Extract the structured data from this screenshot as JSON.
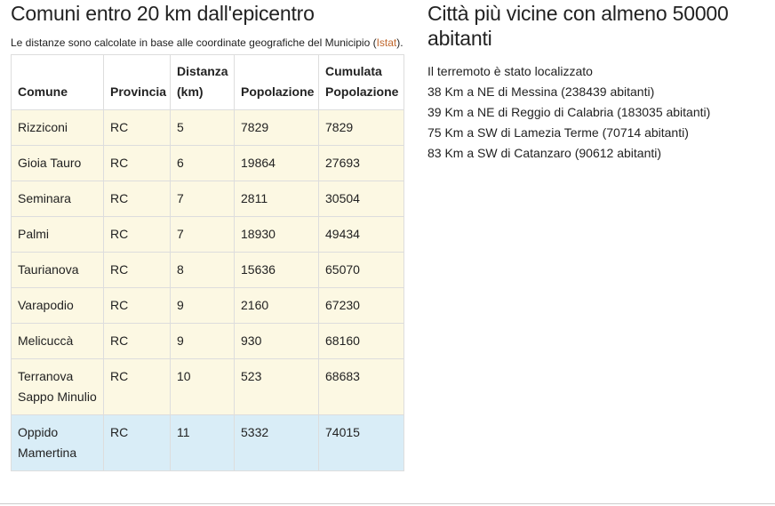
{
  "left": {
    "title": "Comuni entro 20 km dall'epicentro",
    "note_text": "Le distanze sono calcolate in base alle coordinate geografiche del Municipio (",
    "note_link": "Istat",
    "note_end": ").",
    "table": {
      "headers": [
        "Comune",
        "Provincia",
        "Distanza (km)",
        "Popolazione",
        "Cumulata Popolazione"
      ],
      "rows": [
        [
          "Rizziconi",
          "RC",
          "5",
          "7829",
          "7829"
        ],
        [
          "Gioia Tauro",
          "RC",
          "6",
          "19864",
          "27693"
        ],
        [
          "Seminara",
          "RC",
          "7",
          "2811",
          "30504"
        ],
        [
          "Palmi",
          "RC",
          "7",
          "18930",
          "49434"
        ],
        [
          "Taurianova",
          "RC",
          "8",
          "15636",
          "65070"
        ],
        [
          "Varapodio",
          "RC",
          "9",
          "2160",
          "67230"
        ],
        [
          "Melicuccà",
          "RC",
          "9",
          "930",
          "68160"
        ],
        [
          "Terranova Sappo Minulio",
          "RC",
          "10",
          "523",
          "68683"
        ],
        [
          "Oppido Mamertina",
          "RC",
          "11",
          "5332",
          "74015"
        ]
      ]
    }
  },
  "right": {
    "title": "Città più vicine con almeno 50000 abitanti",
    "intro": "Il terremoto è stato localizzato",
    "lines": [
      "38 Km a NE di Messina (238439 abitanti)",
      "39 Km a NE di Reggio di Calabria (183035 abitanti)",
      "75 Km a SW di Lamezia Terme (70714 abitanti)",
      "83 Km a SW di Catanzaro (90612 abitanti)"
    ]
  },
  "colors": {
    "row_bg": "#fcf8e3",
    "highlight_row_bg": "#d9edf7",
    "link": "#c0672c",
    "border": "#dddddd"
  }
}
